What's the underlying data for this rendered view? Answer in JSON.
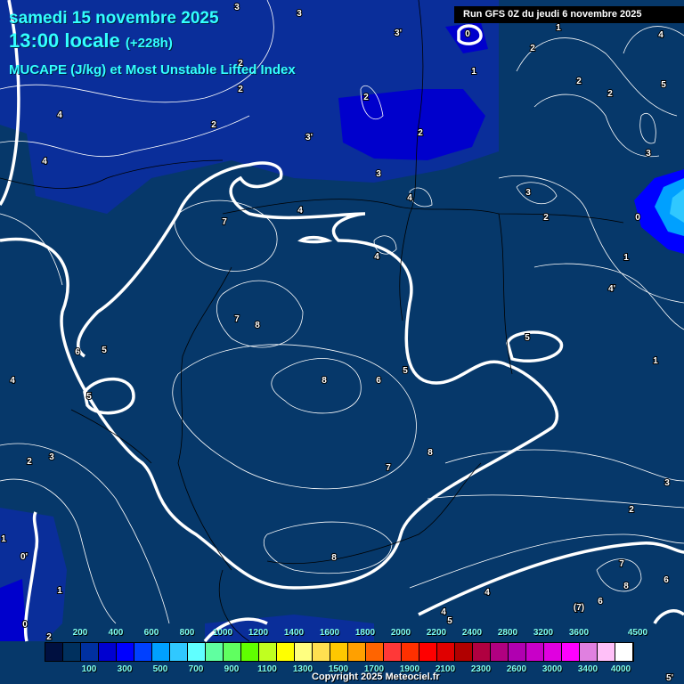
{
  "header": {
    "date": "samedi 15 novembre 2025",
    "time": "13:00 locale",
    "lead": "(+228h)",
    "parameter": "MUCAPE (J/kg) et Most Unstable Lifted Index",
    "run": "Run GFS 0Z du jeudi 6 novembre 2025"
  },
  "contour_labels": [
    "3",
    "3",
    "3'",
    "0",
    "1",
    "2",
    "4",
    "5",
    "4",
    "2",
    "2",
    "2",
    "2",
    "3'",
    "2",
    "1",
    "2",
    "2",
    "3",
    "4",
    "3",
    "4",
    "7",
    "4",
    "4",
    "3",
    "2",
    "1",
    "0",
    "4'",
    "7",
    "8",
    "6",
    "5",
    "5",
    "4",
    "8",
    "6",
    "5",
    "5",
    "1",
    "8",
    "7",
    "2",
    "3",
    "3",
    "2",
    "1",
    "0'",
    "8",
    "7",
    "8",
    "6",
    "4",
    "4",
    "5",
    "(7)",
    "6",
    "5'",
    "1",
    "0",
    "2"
  ],
  "legend": {
    "top_labels": [
      "200",
      "400",
      "600",
      "800",
      "1000",
      "1200",
      "1400",
      "1600",
      "1800",
      "2000",
      "2200",
      "2400",
      "2800",
      "3200",
      "3600",
      "4500"
    ],
    "bottom_labels": [
      "100",
      "300",
      "500",
      "700",
      "900",
      "1100",
      "1300",
      "1500",
      "1700",
      "1900",
      "2100",
      "2300",
      "2600",
      "3000",
      "3400",
      "4000"
    ],
    "colors": [
      "#001040",
      "#00305e",
      "#0030a0",
      "#0000d0",
      "#0000ff",
      "#0040ff",
      "#00a0ff",
      "#30c8ff",
      "#60ffff",
      "#60ffa0",
      "#60ff60",
      "#60ff00",
      "#c0ff20",
      "#ffff00",
      "#ffff80",
      "#ffe050",
      "#ffc800",
      "#ffa000",
      "#ff6400",
      "#ff3838",
      "#ff3000",
      "#ff0000",
      "#e00000",
      "#b00000",
      "#b00040",
      "#b00080",
      "#b000b0",
      "#c800c8",
      "#e000e0",
      "#ff00ff",
      "#e080e0",
      "#ffc0f8",
      "#ffffff"
    ]
  },
  "copyright": "Copyright 2025 Meteociel.fr"
}
